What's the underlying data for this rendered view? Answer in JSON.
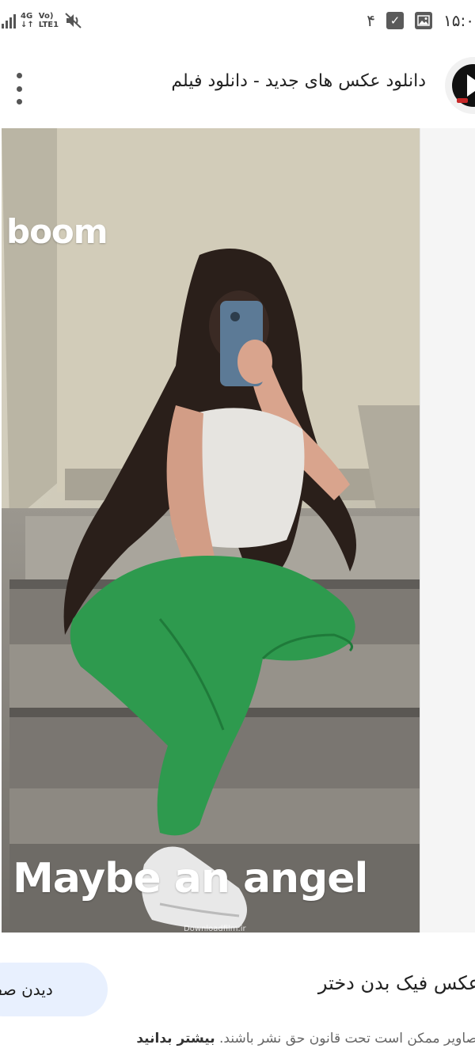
{
  "status_bar": {
    "network_top": "4G",
    "network_bottom": "↓↑",
    "volte_top": "Vo)",
    "volte_bottom": "LTE1",
    "notification_count": "۴",
    "time": "۱۵:۰"
  },
  "header": {
    "title": "دانلود عکس های جدید - دانلود فیلم"
  },
  "image": {
    "caption_top": "boom",
    "caption_bottom": "Maybe an angel",
    "watermark": "Downloadfilm.ir",
    "colors": {
      "pants": "#2e9a4e",
      "wall": "#cfc9b7",
      "stairs": "#8a8680"
    }
  },
  "result": {
    "title": "عکس فیک بدن دختر",
    "visit_button": "دیدن صفحه",
    "copyright_text": "تصاویر ممکن است تحت قانون حق نشر باشند. ",
    "learn_more": "بیشتر بدانید"
  }
}
